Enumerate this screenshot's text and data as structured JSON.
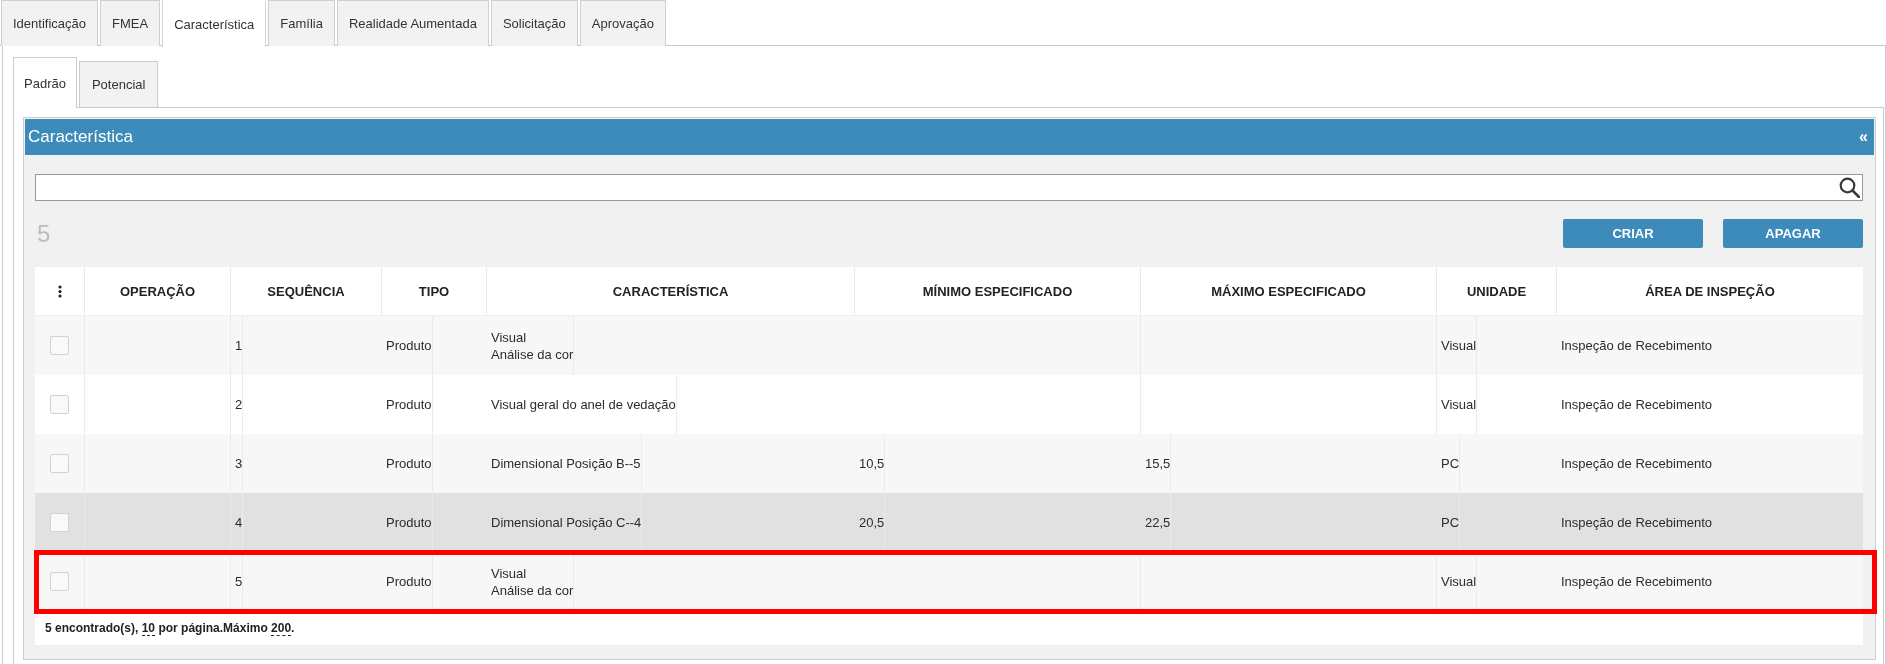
{
  "tabs": [
    {
      "label": "Identificação",
      "selected": false
    },
    {
      "label": "FMEA",
      "selected": false
    },
    {
      "label": "Característica",
      "selected": true
    },
    {
      "label": "Família",
      "selected": false
    },
    {
      "label": "Realidade Aumentada",
      "selected": false
    },
    {
      "label": "Solicitação",
      "selected": false
    },
    {
      "label": "Aprovação",
      "selected": false
    }
  ],
  "subtabs": [
    {
      "label": "Padrão",
      "selected": true
    },
    {
      "label": "Potencial",
      "selected": false
    }
  ],
  "panel": {
    "title": "Característica",
    "collapse_glyph": "«",
    "count": "5",
    "buttons": [
      "CRIAR",
      "APAGAR"
    ]
  },
  "table": {
    "columns": [
      "OPERAÇÃO",
      "SEQUÊNCIA",
      "TIPO",
      "CARACTERÍSTICA",
      "MÍNIMO ESPECIFICADO",
      "MÁXIMO ESPECIFICADO",
      "UNIDADE",
      "ÁREA DE INSPEÇÃO"
    ],
    "rows": [
      {
        "checked": false,
        "hovered": false,
        "outlined": false,
        "sequence": "1",
        "type": "Produto",
        "characteristic": "Visual\nAnálise da cor",
        "unit": "Visual",
        "inspection_area": "Inspeção de Recebimento"
      },
      {
        "checked": false,
        "hovered": false,
        "outlined": false,
        "sequence": "2",
        "type": "Produto",
        "characteristic": "Visual geral do anel de vedação",
        "unit": "Visual",
        "inspection_area": "Inspeção de Recebimento"
      },
      {
        "checked": false,
        "hovered": false,
        "outlined": false,
        "sequence": "3",
        "type": "Produto",
        "characteristic": "Dimensional Posição B--5",
        "minimum": "10,5",
        "maximum": "15,5",
        "unit": "PC",
        "inspection_area": "Inspeção de Recebimento"
      },
      {
        "checked": false,
        "hovered": true,
        "outlined": false,
        "sequence": "4",
        "type": "Produto",
        "characteristic": "Dimensional Posição C--4",
        "minimum": "20,5",
        "maximum": "22,5",
        "unit": "PC",
        "inspection_area": "Inspeção de Recebimento"
      },
      {
        "checked": false,
        "hovered": false,
        "outlined": true,
        "sequence": "5",
        "type": "Produto",
        "characteristic": "Visual\nAnálise da cor",
        "unit": "Visual",
        "inspection_area": "Inspeção de Recebimento"
      }
    ],
    "footer": [
      {
        "kind": "text",
        "text": "5 encontrado(s), "
      },
      {
        "kind": "link",
        "text": "10"
      },
      {
        "kind": "text",
        "text": " por página.Máximo "
      },
      {
        "kind": "link",
        "text": "200"
      },
      {
        "kind": "text",
        "text": "."
      }
    ]
  }
}
